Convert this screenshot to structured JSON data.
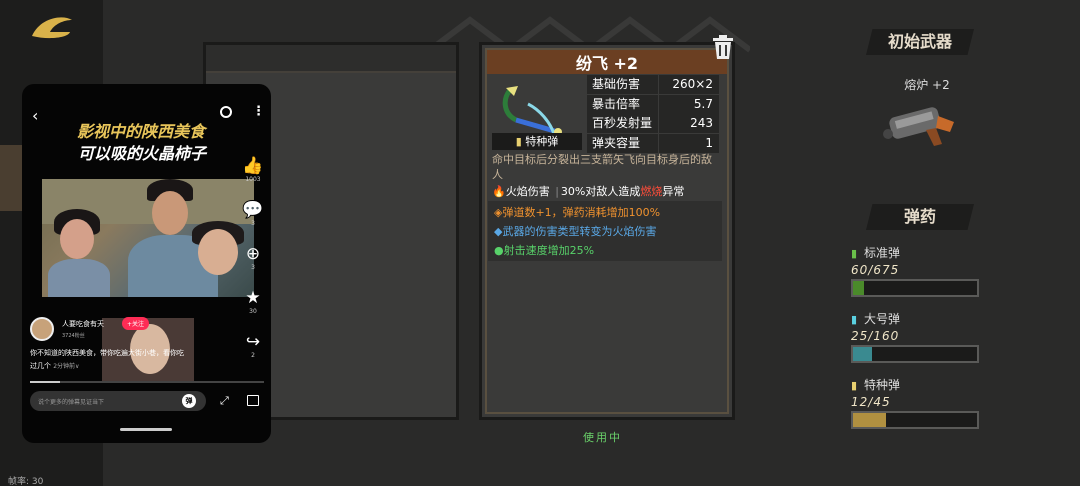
{
  "app": {
    "fps_label": "帧率: 30"
  },
  "phone": {
    "title_line1": "影视中的陕西美食",
    "title_line2": "可以吸的火晶柿子",
    "side_actions": [
      {
        "icon": "thumbs-up-icon",
        "count": "1003"
      },
      {
        "icon": "comment-icon",
        "count": "3"
      },
      {
        "icon": "tea-cup-icon",
        "count": "3"
      },
      {
        "icon": "star-icon",
        "count": "30"
      },
      {
        "icon": "share-icon",
        "count": "2"
      }
    ],
    "author": "人要吃食有天",
    "fans": "3724粉丝",
    "follow_label": "+关注",
    "desc_line1": "你不知道的陕西美食，带你吃遍大街小巷，看你吃",
    "desc_line2": "过几个",
    "desc_more": "2分钟前∨",
    "comment_placeholder": "说个更多的弹幕见证当下",
    "ai_badge": "弹",
    "icons": [
      "back-icon",
      "search-icon",
      "more-icon",
      "expand-icon",
      "pip-icon"
    ]
  },
  "weapon": {
    "name": "纷飞 +2",
    "ammo_type": "特种弹",
    "stats": [
      {
        "label": "基础伤害",
        "value": "260×2"
      },
      {
        "label": "暴击倍率",
        "value": "5.7"
      },
      {
        "label": "百秒发射量",
        "value": "243"
      },
      {
        "label": "弹夹容量",
        "value": "1"
      }
    ],
    "description": "命中目标后分裂出三支箭矢飞向目标身后的敌人",
    "damage_type": "火焰伤害",
    "status_prefix": "30%对敌人造成",
    "status_effect": "燃烧",
    "status_suffix": "异常",
    "modifiers": [
      {
        "text": "◈弹道数+1，弹药消耗增加100%",
        "color": "#f0922e"
      },
      {
        "text": "◆武器的伤害类型转变为火焰伤害",
        "color": "#5aa8e6"
      },
      {
        "text": "●射击速度增加25%",
        "color": "#58d26a"
      }
    ],
    "status_label": "使用中"
  },
  "sidebar": {
    "initial_weapon_title": "初始武器",
    "initial_weapon_name": "熔炉 +2",
    "ammo_title": "弹药",
    "ammo": [
      {
        "name": "标准弹",
        "current": 60,
        "max": 675,
        "count_text": "60/675",
        "fraction": 0.089,
        "color": "#4a8a2a",
        "icon": "standard-ammo-icon"
      },
      {
        "name": "大号弹",
        "current": 25,
        "max": 160,
        "count_text": "25/160",
        "fraction": 0.156,
        "color": "#3a8a90",
        "icon": "large-ammo-icon"
      },
      {
        "name": "特种弹",
        "current": 12,
        "max": 45,
        "count_text": "12/45",
        "fraction": 0.267,
        "color": "#b09040",
        "icon": "special-ammo-icon"
      }
    ]
  }
}
